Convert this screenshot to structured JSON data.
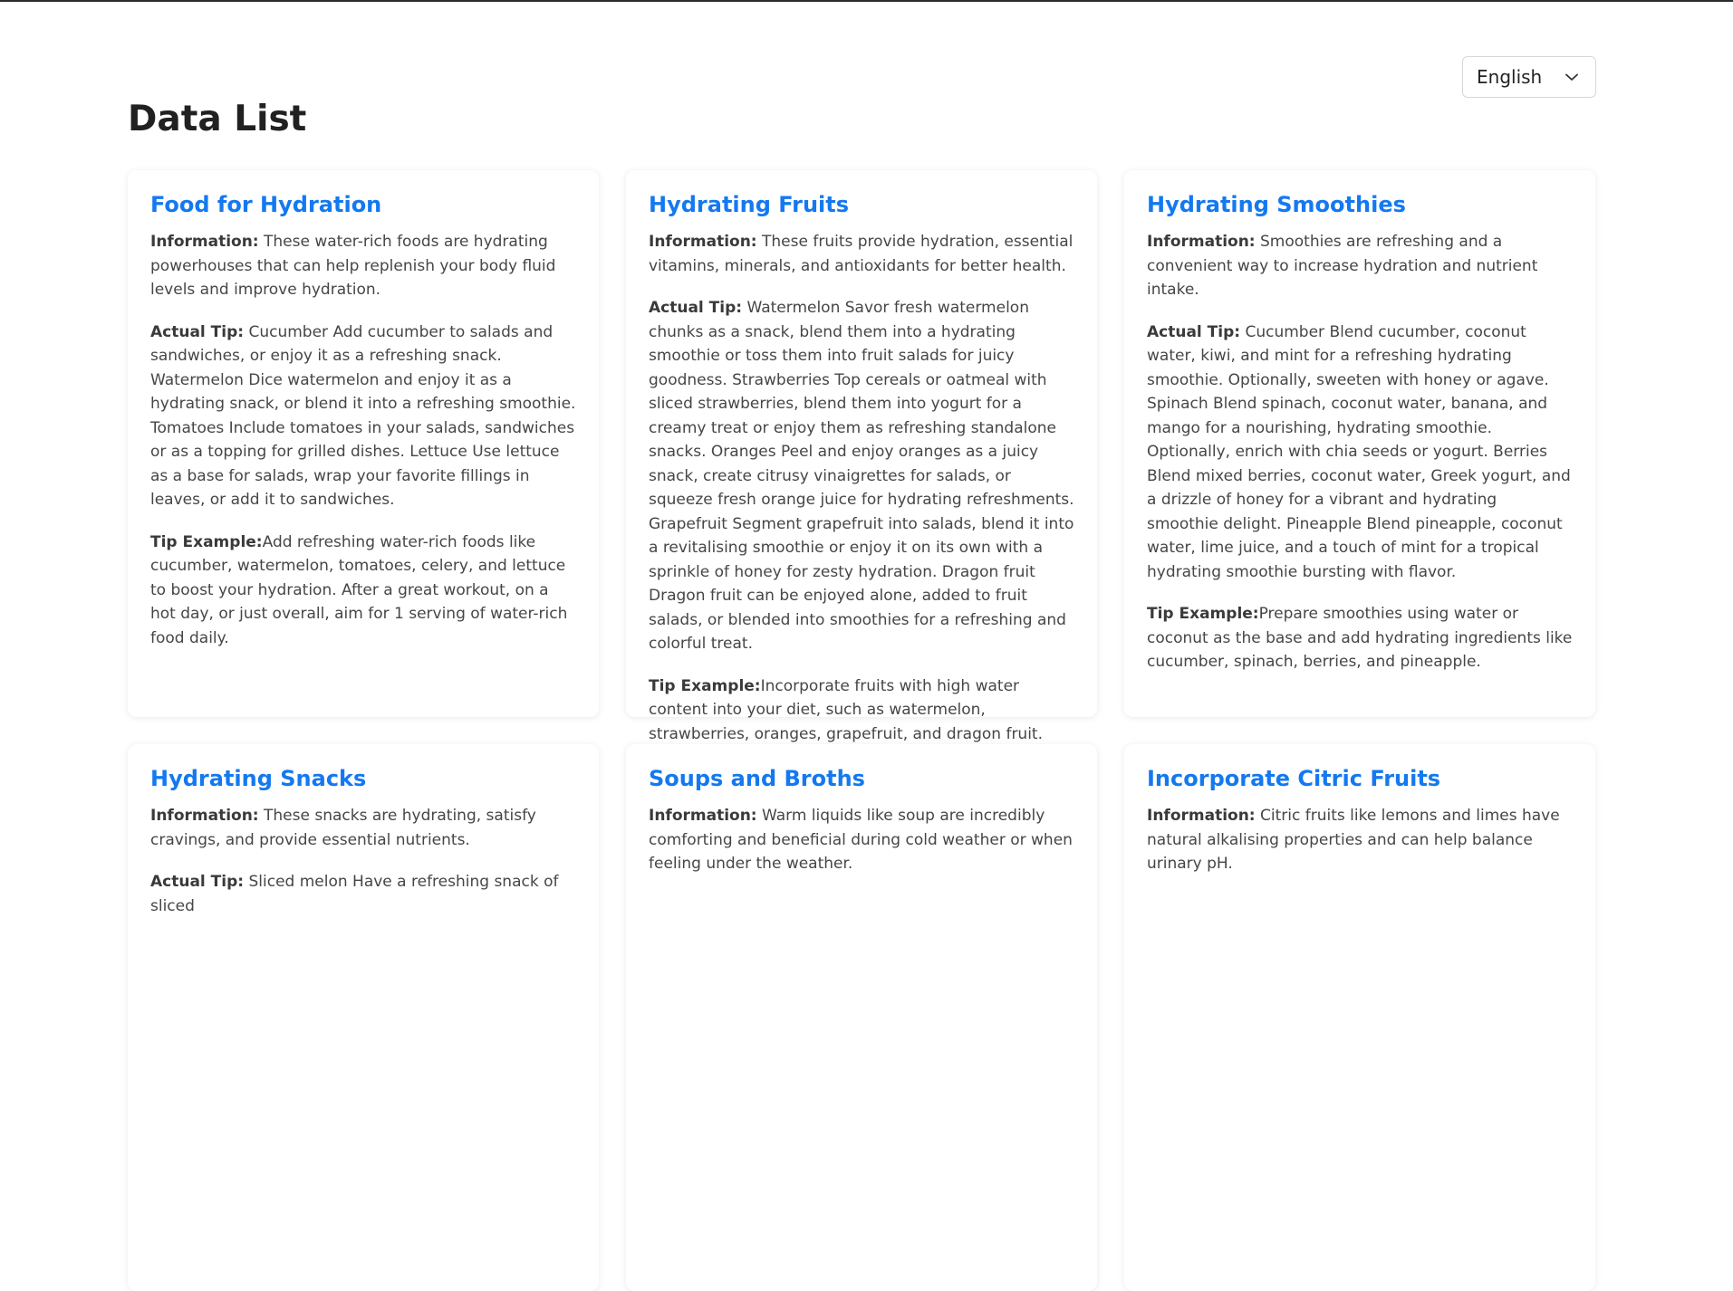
{
  "language_select": {
    "value": "English"
  },
  "page": {
    "title": "Data List"
  },
  "cards": [
    {
      "title": "Food for Hydration",
      "information_label": "Information:",
      "information": "These water-rich foods are hydrating powerhouses that can help replenish your body fluid levels and improve hydration.",
      "tip_label": "Actual Tip:",
      "tip": "Cucumber Add cucumber to salads and sandwiches, or enjoy it as a refreshing snack. Watermelon Dice watermelon and enjoy it as a hydrating snack, or blend it into a refreshing smoothie. Tomatoes Include tomatoes in your salads, sandwiches or as a topping for grilled dishes. Lettuce Use lettuce as a base for salads, wrap your favorite fillings in leaves, or add it to sandwiches.",
      "example_label": "Tip Example:",
      "example": "Add refreshing water-rich foods like cucumber, watermelon, tomatoes, celery, and lettuce to boost your hydration. After a great workout, on a hot day, or just overall, aim for 1 serving of water-rich food daily."
    },
    {
      "title": "Hydrating Fruits",
      "information_label": "Information:",
      "information": "These fruits provide hydration, essential vitamins, minerals, and antioxidants for better health.",
      "tip_label": "Actual Tip:",
      "tip": "Watermelon Savor fresh watermelon chunks as a snack, blend them into a hydrating smoothie or toss them into fruit salads for juicy goodness. Strawberries Top cereals or oatmeal with sliced strawberries, blend them into yogurt for a creamy treat or enjoy them as refreshing standalone snacks. Oranges Peel and enjoy oranges as a juicy snack, create citrusy vinaigrettes for salads, or squeeze fresh orange juice for hydrating refreshments. Grapefruit Segment grapefruit into salads, blend it into a revitalising smoothie or enjoy it on its own with a sprinkle of honey for zesty hydration. Dragon fruit Dragon fruit can be enjoyed alone, added to fruit salads, or blended into smoothies for a refreshing and colorful treat.",
      "example_label": "Tip Example:",
      "example": "Incorporate fruits with high water content into your diet, such as watermelon, strawberries, oranges, grapefruit, and dragon fruit."
    },
    {
      "title": "Hydrating Smoothies",
      "information_label": "Information:",
      "information": "Smoothies are refreshing and a convenient way to increase hydration and nutrient intake.",
      "tip_label": "Actual Tip:",
      "tip": "Cucumber Blend cucumber, coconut water, kiwi, and mint for a refreshing hydrating smoothie. Optionally, sweeten with honey or agave. Spinach Blend spinach, coconut water, banana, and mango for a nourishing, hydrating smoothie. Optionally, enrich with chia seeds or yogurt. Berries Blend mixed berries, coconut water, Greek yogurt, and a drizzle of honey for a vibrant and hydrating smoothie delight. Pineapple Blend pineapple, coconut water, lime juice, and a touch of mint for a tropical hydrating smoothie bursting with flavor.",
      "example_label": "Tip Example:",
      "example": "Prepare smoothies using water or coconut as the base and add hydrating ingredients like cucumber, spinach, berries, and pineapple."
    },
    {
      "title": "Hydrating Snacks",
      "information_label": "Information:",
      "information": "These snacks are hydrating, satisfy cravings, and provide essential nutrients.",
      "tip_label": "Actual Tip:",
      "tip": "Sliced melon Have a refreshing snack of sliced",
      "example_label": "",
      "example": ""
    },
    {
      "title": "Soups and Broths",
      "information_label": "Information:",
      "information": "Warm liquids like soup are incredibly comforting and beneficial during cold weather or when feeling under the weather.",
      "tip_label": "",
      "tip": "",
      "example_label": "",
      "example": ""
    },
    {
      "title": "Incorporate Citric Fruits",
      "information_label": "Information:",
      "information": "Citric fruits like lemons and limes have natural alkalising properties and can help balance urinary pH.",
      "tip_label": "",
      "tip": "",
      "example_label": "",
      "example": ""
    }
  ]
}
